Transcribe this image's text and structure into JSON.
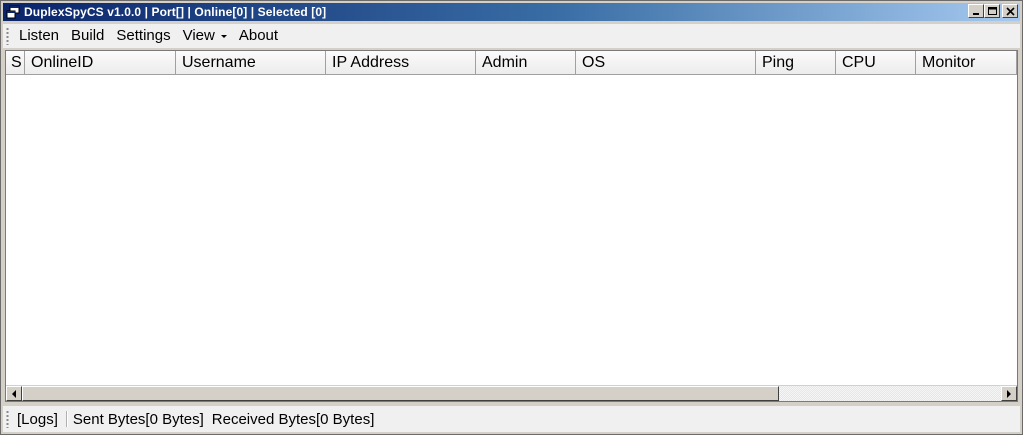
{
  "window": {
    "title": "DuplexSpyCS v1.0.0 | Port[] | Online[0] | Selected [0]",
    "icon": "app-window-icon"
  },
  "menu": {
    "items": [
      {
        "label": "Listen"
      },
      {
        "label": "Build"
      },
      {
        "label": "Settings"
      },
      {
        "label": "View",
        "has_dropdown": true
      },
      {
        "label": "About"
      }
    ]
  },
  "table": {
    "columns": [
      "S",
      "OnlineID",
      "Username",
      "IP Address",
      "Admin",
      "OS",
      "Ping",
      "CPU",
      "Monitor"
    ],
    "rows": []
  },
  "status": {
    "logs": "[Logs]",
    "sent": "Sent Bytes[0 Bytes]",
    "received": "Received Bytes[0 Bytes]"
  },
  "colors": {
    "title_start": "#0a246a",
    "title_end": "#a6caf0",
    "chrome": "#d4d0c8",
    "menu_bg": "#f0f0f0"
  }
}
